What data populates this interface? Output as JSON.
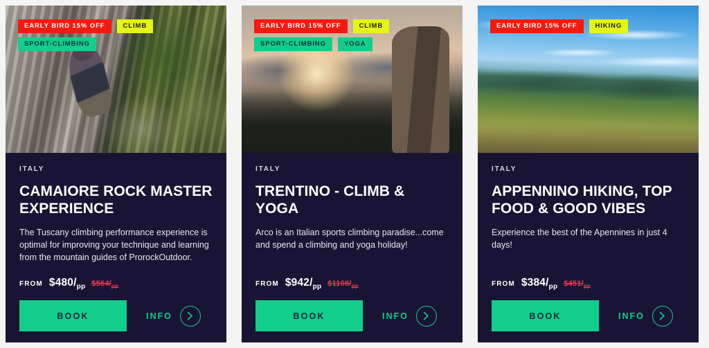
{
  "colors": {
    "page_background": "#f4f4f4",
    "card_background": "#1a1434",
    "accent_green": "#12ce8c",
    "badge_deal_red": "#f41a0e",
    "badge_sport_yellow": "#e6f516",
    "old_price_red": "#f0384f"
  },
  "cards": [
    {
      "photo_style": "photo-climb-cliff",
      "photo_alt": "climber-on-limestone-cliff",
      "badges": [
        {
          "label": "EARLY BIRD 15% OFF",
          "style": "badge-deal"
        },
        {
          "label": "CLIMB",
          "style": "badge-sport"
        },
        {
          "label": "SPORT-CLIMBING",
          "style": "badge-green"
        }
      ],
      "country": "ITALY",
      "title": "CAMAIORE ROCK MASTER EXPERIENCE",
      "description": "The Tuscany climbing performance experience is optimal for improving your technique and learning from the mountain guides of ProrockOutdoor.",
      "from_label": "FROM",
      "price_now": "$480/",
      "price_now_unit": "pp",
      "price_old": "$564/",
      "price_old_unit": "pp",
      "book_label": "BOOK",
      "info_label": "INFO"
    },
    {
      "photo_style": "photo-sunset-tower",
      "photo_alt": "sunset-over-lake-with-rock-tower",
      "badges": [
        {
          "label": "EARLY BIRD 15% OFF",
          "style": "badge-deal"
        },
        {
          "label": "CLIMB",
          "style": "badge-sport"
        },
        {
          "label": "SPORT-CLIMBING",
          "style": "badge-green"
        },
        {
          "label": "YOGA",
          "style": "badge-green"
        }
      ],
      "country": "ITALY",
      "title": "TRENTINO - CLIMB & YOGA",
      "description": "Arco is an Italian sports climbing paradise...come and spend a climbing and yoga holiday!",
      "from_label": "FROM",
      "price_now": "$942/",
      "price_now_unit": "pp",
      "price_old": "$1108/",
      "price_old_unit": "pp",
      "book_label": "BOOK",
      "info_label": "INFO"
    },
    {
      "photo_style": "photo-sky-ridge",
      "photo_alt": "blue-sky-over-green-mountain-ridge",
      "badges": [
        {
          "label": "EARLY BIRD 15% OFF",
          "style": "badge-deal"
        },
        {
          "label": "HIKING",
          "style": "badge-sport"
        }
      ],
      "country": "ITALY",
      "title": "APPENNINO HIKING, TOP FOOD & GOOD VIBES",
      "description": "Experience the best of the Apennines in just 4 days!",
      "from_label": "FROM",
      "price_now": "$384/",
      "price_now_unit": "pp",
      "price_old": "$451/",
      "price_old_unit": "pp",
      "book_label": "BOOK",
      "info_label": "INFO"
    }
  ]
}
